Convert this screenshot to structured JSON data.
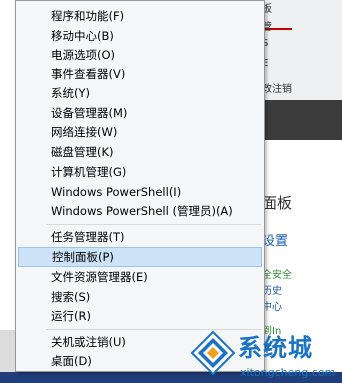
{
  "menu": {
    "items": [
      {
        "label": "程序和功能(F)"
      },
      {
        "label": "移动中心(B)"
      },
      {
        "label": "电源选项(O)"
      },
      {
        "label": "事件查看器(V)"
      },
      {
        "label": "系统(Y)"
      },
      {
        "label": "设备管理器(M)"
      },
      {
        "label": "网络连接(W)"
      },
      {
        "label": "磁盘管理(K)"
      },
      {
        "label": "计算机管理(G)"
      },
      {
        "label": "Windows PowerShell(I)"
      },
      {
        "label": "Windows PowerShell (管理员)(A)"
      },
      {
        "label": "任务管理器(T)"
      },
      {
        "label": "控制面板(P)"
      },
      {
        "label": "文件资源管理器(E)"
      },
      {
        "label": "搜索(S)"
      },
      {
        "label": "运行(R)"
      },
      {
        "label": "关机或注销(U)"
      },
      {
        "label": "桌面(D)"
      }
    ],
    "highlighted_index": 12
  },
  "background": {
    "fragments": [
      "板",
      "管",
      "S",
      "E",
      "改注销",
      "面板",
      "设置",
      "全安全",
      "历史",
      "中心",
      "到In",
      "本"
    ]
  },
  "watermark": {
    "title": "系统城",
    "url": "xitongcheng.com"
  },
  "colors": {
    "menu_bg": "#f5f6f7",
    "highlight": "#cde3f7",
    "watermark_blue": "#1b73c6"
  }
}
